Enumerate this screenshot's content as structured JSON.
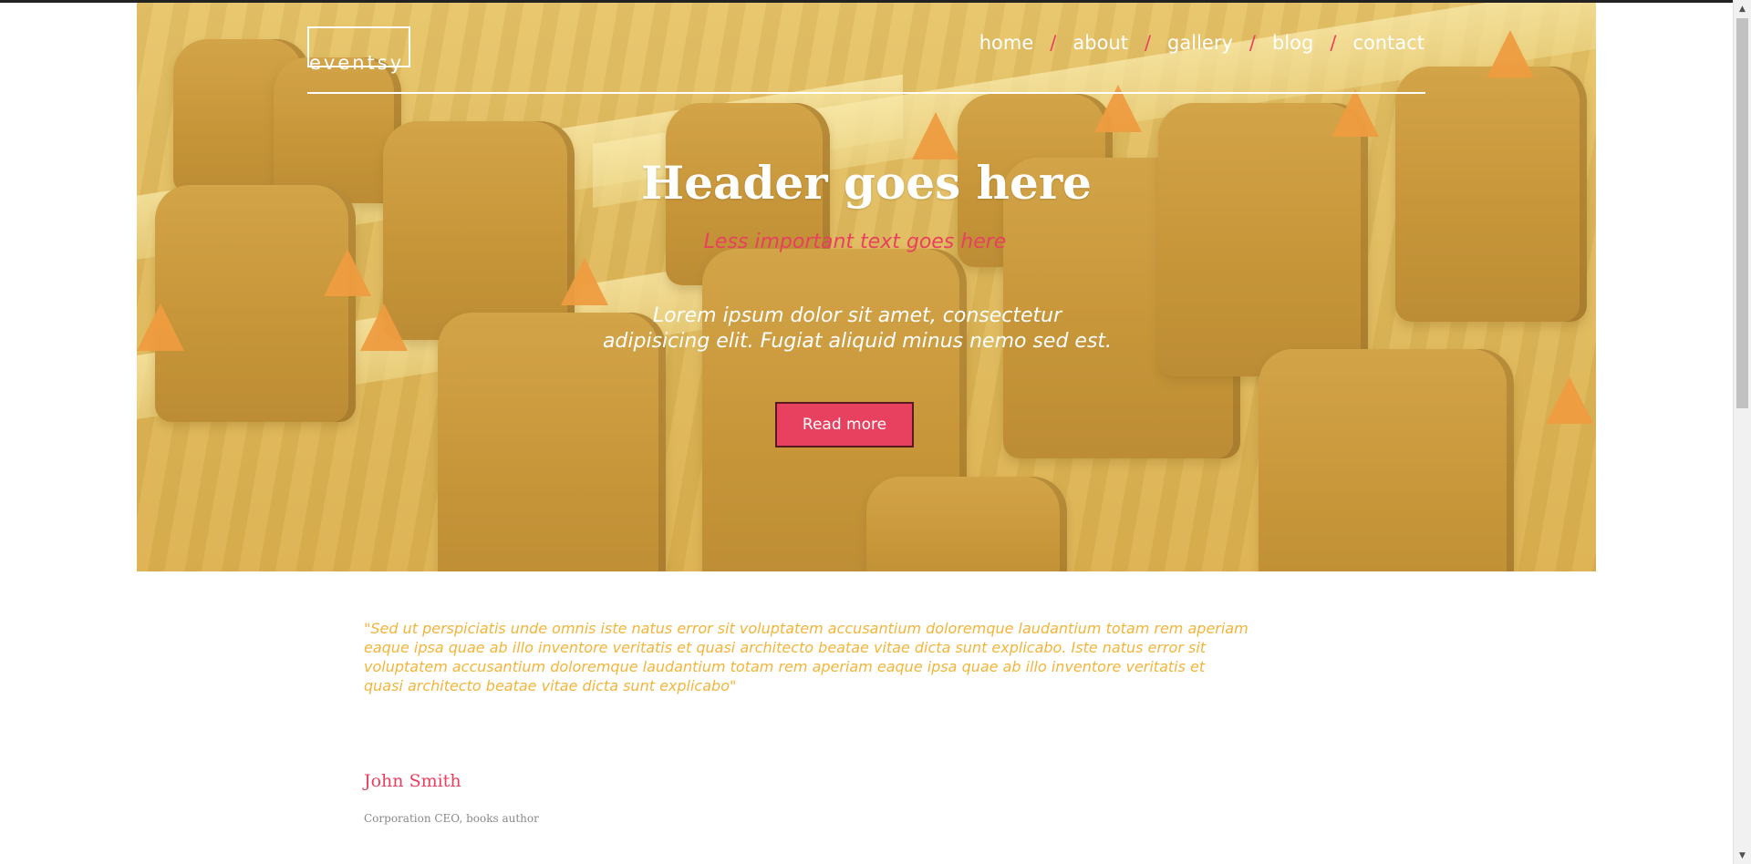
{
  "brand": {
    "logo": "eventsy"
  },
  "nav": {
    "items": [
      "home",
      "about",
      "gallery",
      "blog",
      "contact"
    ],
    "separator": "/"
  },
  "hero": {
    "title": "Header goes here",
    "subtitle": "Less important text goes here",
    "lorem": "Lorem ipsum dolor sit amet, consectetur adipisicing elit. Fugiat aliquid minus nemo sed est.",
    "button": "Read more"
  },
  "testimonial": {
    "quote": "\"Sed ut perspiciatis unde omnis iste natus error sit voluptatem accusantium doloremque laudantium totam rem aperiam eaque ipsa quae ab illo inventore veritatis et quasi architecto beatae vitae dicta sunt explicabo. Iste natus error sit voluptatem accusantium doloremque laudantium totam rem aperiam eaque ipsa quae ab illo inventore veritatis et quasi architecto beatae vitae dicta sunt explicabo\"",
    "author": "John Smith",
    "role": "Corporation CEO, books author"
  },
  "colors": {
    "accent": "#e8405f",
    "quote": "#f2b53a",
    "hero_overlay": "#ecc850"
  },
  "scrollbar": {
    "up_icon": "triangle-up-icon",
    "down_icon": "triangle-down-icon"
  }
}
